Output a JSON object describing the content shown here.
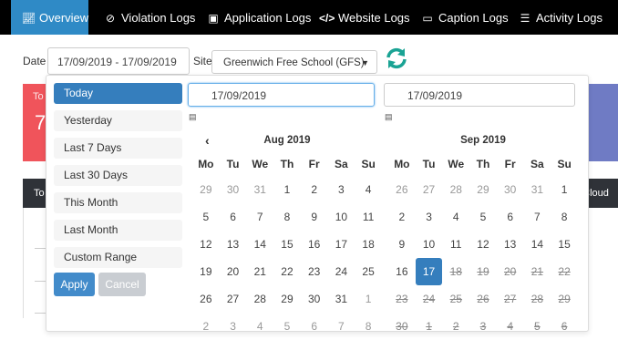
{
  "nav": {
    "tabs": [
      {
        "label": "Overview",
        "icon": "chart-icon",
        "active": true
      },
      {
        "label": "Violation Logs",
        "icon": "ban-icon",
        "active": false
      },
      {
        "label": "Application Logs",
        "icon": "app-window-icon",
        "active": false
      },
      {
        "label": "Website Logs",
        "icon": "code-icon",
        "active": false
      },
      {
        "label": "Caption Logs",
        "icon": "caption-icon",
        "active": false
      },
      {
        "label": "Activity Logs",
        "icon": "list-icon",
        "active": false
      }
    ]
  },
  "filters": {
    "date_label": "Date",
    "date_value": "17/09/2019 - 17/09/2019",
    "site_label": "Site",
    "site_value": "Greenwich Free School (GFS)"
  },
  "background": {
    "card_title": "To",
    "card_value": "7",
    "bar_left": "To",
    "bar_right": "d Cloud"
  },
  "picker": {
    "ranges": [
      "Today",
      "Yesterday",
      "Last 7 Days",
      "Last 30 Days",
      "This Month",
      "Last Month",
      "Custom Range"
    ],
    "active_range": "Today",
    "apply_label": "Apply",
    "cancel_label": "Cancel",
    "start_input": "17/09/2019",
    "end_input": "17/09/2019",
    "weekdays": [
      "Mo",
      "Tu",
      "We",
      "Th",
      "Fr",
      "Sa",
      "Su"
    ],
    "left_month": {
      "title": "Aug 2019",
      "weeks": [
        [
          "29",
          "30",
          "31",
          "1",
          "2",
          "3",
          "4"
        ],
        [
          "5",
          "6",
          "7",
          "8",
          "9",
          "10",
          "11"
        ],
        [
          "12",
          "13",
          "14",
          "15",
          "16",
          "17",
          "18"
        ],
        [
          "19",
          "20",
          "21",
          "22",
          "23",
          "24",
          "25"
        ],
        [
          "26",
          "27",
          "28",
          "29",
          "30",
          "31",
          "1"
        ],
        [
          "2",
          "3",
          "4",
          "5",
          "6",
          "7",
          "8"
        ]
      ]
    },
    "right_month": {
      "title": "Sep 2019",
      "selected": "17",
      "weeks": [
        [
          "26",
          "27",
          "28",
          "29",
          "30",
          "31",
          "1"
        ],
        [
          "2",
          "3",
          "4",
          "5",
          "6",
          "7",
          "8"
        ],
        [
          "9",
          "10",
          "11",
          "12",
          "13",
          "14",
          "15"
        ],
        [
          "16",
          "17",
          "18",
          "19",
          "20",
          "21",
          "22"
        ],
        [
          "23",
          "24",
          "25",
          "26",
          "27",
          "28",
          "29"
        ],
        [
          "30",
          "1",
          "2",
          "3",
          "4",
          "5",
          "6"
        ]
      ]
    }
  },
  "colors": {
    "nav_bg": "#000000",
    "nav_active": "#2f8ac6",
    "selected_day": "#357ebd",
    "apply_button": "#428bca",
    "refresh_icon": "#1aa394",
    "card_red": "#f0545b",
    "card_purple": "#6f7bc4"
  }
}
